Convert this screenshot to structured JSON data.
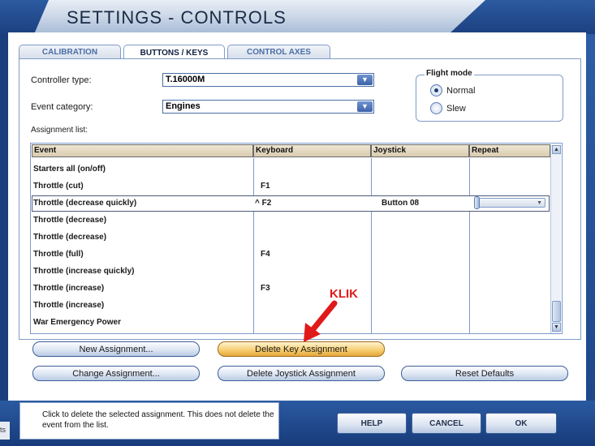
{
  "window": {
    "title": "SETTINGS - CONTROLS"
  },
  "tabs": [
    {
      "label": "CALIBRATION",
      "active": false
    },
    {
      "label": "BUTTONS / KEYS",
      "active": true
    },
    {
      "label": "CONTROL AXES",
      "active": false
    }
  ],
  "form": {
    "controller_type_label": "Controller type:",
    "controller_type_value": "T.16000M",
    "event_category_label": "Event category:",
    "event_category_value": "Engines",
    "assignment_list_label": "Assignment list:"
  },
  "flight_mode": {
    "legend": "Flight mode",
    "options": [
      {
        "label": "Normal",
        "selected": true
      },
      {
        "label": "Slew",
        "selected": false
      }
    ]
  },
  "table": {
    "columns": [
      "Event",
      "Keyboard",
      "Joystick",
      "Repeat"
    ],
    "rows": [
      {
        "event": "Starters all (on/off)",
        "keyboard": "",
        "joystick": ""
      },
      {
        "event": "Throttle (cut)",
        "keyboard": "F1",
        "joystick": ""
      },
      {
        "event": "Throttle (decrease quickly)",
        "keyboard": "^ F2",
        "joystick": "Button 08",
        "selected": true
      },
      {
        "event": "Throttle (decrease)",
        "keyboard": "",
        "joystick": ""
      },
      {
        "event": "Throttle (decrease)",
        "keyboard": "",
        "joystick": ""
      },
      {
        "event": "Throttle (full)",
        "keyboard": "F4",
        "joystick": ""
      },
      {
        "event": "Throttle (increase quickly)",
        "keyboard": "",
        "joystick": ""
      },
      {
        "event": "Throttle (increase)",
        "keyboard": "F3",
        "joystick": ""
      },
      {
        "event": "Throttle (increase)",
        "keyboard": "",
        "joystick": ""
      },
      {
        "event": "War Emergency Power",
        "keyboard": "",
        "joystick": ""
      }
    ]
  },
  "annotation": {
    "text": "KLIK",
    "color": "#e01a1a"
  },
  "buttons": {
    "new_assignment": "New Assignment...",
    "delete_key_assignment": "Delete Key Assignment",
    "change_assignment": "Change Assignment...",
    "delete_joystick_assignment": "Delete Joystick Assignment",
    "reset_defaults": "Reset Defaults"
  },
  "help": {
    "text": "Click to delete the selected assignment. This does not delete the event from the list.",
    "left_stub": "ts"
  },
  "footer": {
    "help": "HELP",
    "cancel": "CANCEL",
    "ok": "OK"
  },
  "colors": {
    "frame": "#2d5fa8",
    "header_bg": "#d9cbb0",
    "accent_orange": "#f6cc6c"
  }
}
